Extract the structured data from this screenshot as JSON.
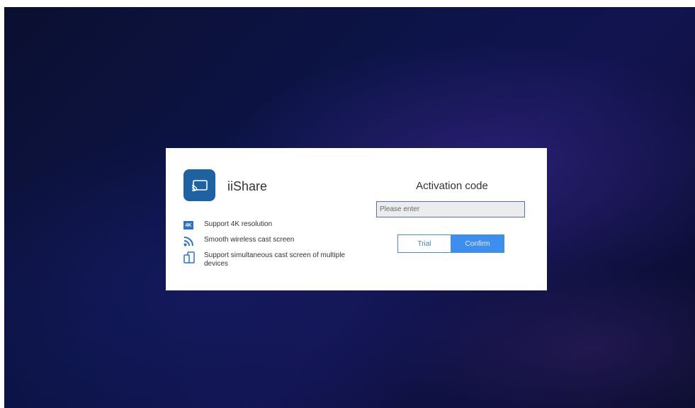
{
  "app": {
    "name": "iiShare",
    "icon": "cast-screen-icon",
    "icon_color": "#1d62a3"
  },
  "features": [
    {
      "icon": "4k-icon",
      "badge": "4K",
      "label": "Support 4K resolution"
    },
    {
      "icon": "wireless-cast-icon",
      "label": "Smooth wireless cast screen"
    },
    {
      "icon": "multi-device-icon",
      "label": "Support simultaneous cast screen of multiple devices"
    }
  ],
  "activation": {
    "title": "Activation code",
    "placeholder": "Please enter",
    "value": ""
  },
  "buttons": {
    "trial_label": "Trial",
    "confirm_label": "Confirm"
  },
  "colors": {
    "accent": "#3e8ef0",
    "input_border": "#4a6fd0",
    "background": "#0c1448"
  }
}
